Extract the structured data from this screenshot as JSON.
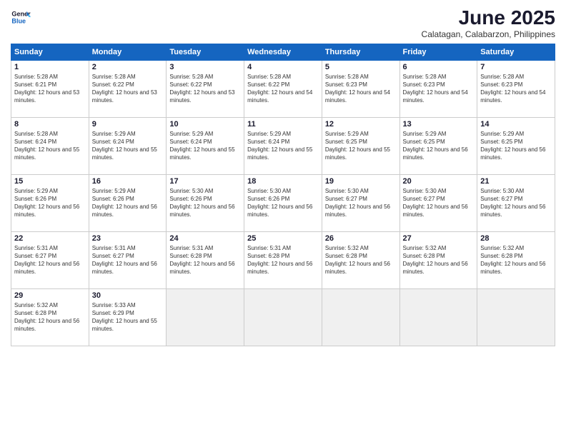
{
  "logo": {
    "line1": "General",
    "line2": "Blue"
  },
  "title": "June 2025",
  "location": "Calatagan, Calabarzon, Philippines",
  "headers": [
    "Sunday",
    "Monday",
    "Tuesday",
    "Wednesday",
    "Thursday",
    "Friday",
    "Saturday"
  ],
  "weeks": [
    [
      {
        "day": "1",
        "sunrise": "5:28 AM",
        "sunset": "6:21 PM",
        "daylight": "12 hours and 53 minutes."
      },
      {
        "day": "2",
        "sunrise": "5:28 AM",
        "sunset": "6:22 PM",
        "daylight": "12 hours and 53 minutes."
      },
      {
        "day": "3",
        "sunrise": "5:28 AM",
        "sunset": "6:22 PM",
        "daylight": "12 hours and 53 minutes."
      },
      {
        "day": "4",
        "sunrise": "5:28 AM",
        "sunset": "6:22 PM",
        "daylight": "12 hours and 54 minutes."
      },
      {
        "day": "5",
        "sunrise": "5:28 AM",
        "sunset": "6:23 PM",
        "daylight": "12 hours and 54 minutes."
      },
      {
        "day": "6",
        "sunrise": "5:28 AM",
        "sunset": "6:23 PM",
        "daylight": "12 hours and 54 minutes."
      },
      {
        "day": "7",
        "sunrise": "5:28 AM",
        "sunset": "6:23 PM",
        "daylight": "12 hours and 54 minutes."
      }
    ],
    [
      {
        "day": "8",
        "sunrise": "5:28 AM",
        "sunset": "6:24 PM",
        "daylight": "12 hours and 55 minutes."
      },
      {
        "day": "9",
        "sunrise": "5:29 AM",
        "sunset": "6:24 PM",
        "daylight": "12 hours and 55 minutes."
      },
      {
        "day": "10",
        "sunrise": "5:29 AM",
        "sunset": "6:24 PM",
        "daylight": "12 hours and 55 minutes."
      },
      {
        "day": "11",
        "sunrise": "5:29 AM",
        "sunset": "6:24 PM",
        "daylight": "12 hours and 55 minutes."
      },
      {
        "day": "12",
        "sunrise": "5:29 AM",
        "sunset": "6:25 PM",
        "daylight": "12 hours and 55 minutes."
      },
      {
        "day": "13",
        "sunrise": "5:29 AM",
        "sunset": "6:25 PM",
        "daylight": "12 hours and 56 minutes."
      },
      {
        "day": "14",
        "sunrise": "5:29 AM",
        "sunset": "6:25 PM",
        "daylight": "12 hours and 56 minutes."
      }
    ],
    [
      {
        "day": "15",
        "sunrise": "5:29 AM",
        "sunset": "6:26 PM",
        "daylight": "12 hours and 56 minutes."
      },
      {
        "day": "16",
        "sunrise": "5:29 AM",
        "sunset": "6:26 PM",
        "daylight": "12 hours and 56 minutes."
      },
      {
        "day": "17",
        "sunrise": "5:30 AM",
        "sunset": "6:26 PM",
        "daylight": "12 hours and 56 minutes."
      },
      {
        "day": "18",
        "sunrise": "5:30 AM",
        "sunset": "6:26 PM",
        "daylight": "12 hours and 56 minutes."
      },
      {
        "day": "19",
        "sunrise": "5:30 AM",
        "sunset": "6:27 PM",
        "daylight": "12 hours and 56 minutes."
      },
      {
        "day": "20",
        "sunrise": "5:30 AM",
        "sunset": "6:27 PM",
        "daylight": "12 hours and 56 minutes."
      },
      {
        "day": "21",
        "sunrise": "5:30 AM",
        "sunset": "6:27 PM",
        "daylight": "12 hours and 56 minutes."
      }
    ],
    [
      {
        "day": "22",
        "sunrise": "5:31 AM",
        "sunset": "6:27 PM",
        "daylight": "12 hours and 56 minutes."
      },
      {
        "day": "23",
        "sunrise": "5:31 AM",
        "sunset": "6:27 PM",
        "daylight": "12 hours and 56 minutes."
      },
      {
        "day": "24",
        "sunrise": "5:31 AM",
        "sunset": "6:28 PM",
        "daylight": "12 hours and 56 minutes."
      },
      {
        "day": "25",
        "sunrise": "5:31 AM",
        "sunset": "6:28 PM",
        "daylight": "12 hours and 56 minutes."
      },
      {
        "day": "26",
        "sunrise": "5:32 AM",
        "sunset": "6:28 PM",
        "daylight": "12 hours and 56 minutes."
      },
      {
        "day": "27",
        "sunrise": "5:32 AM",
        "sunset": "6:28 PM",
        "daylight": "12 hours and 56 minutes."
      },
      {
        "day": "28",
        "sunrise": "5:32 AM",
        "sunset": "6:28 PM",
        "daylight": "12 hours and 56 minutes."
      }
    ],
    [
      {
        "day": "29",
        "sunrise": "5:32 AM",
        "sunset": "6:28 PM",
        "daylight": "12 hours and 56 minutes."
      },
      {
        "day": "30",
        "sunrise": "5:33 AM",
        "sunset": "6:29 PM",
        "daylight": "12 hours and 55 minutes."
      },
      null,
      null,
      null,
      null,
      null
    ]
  ]
}
